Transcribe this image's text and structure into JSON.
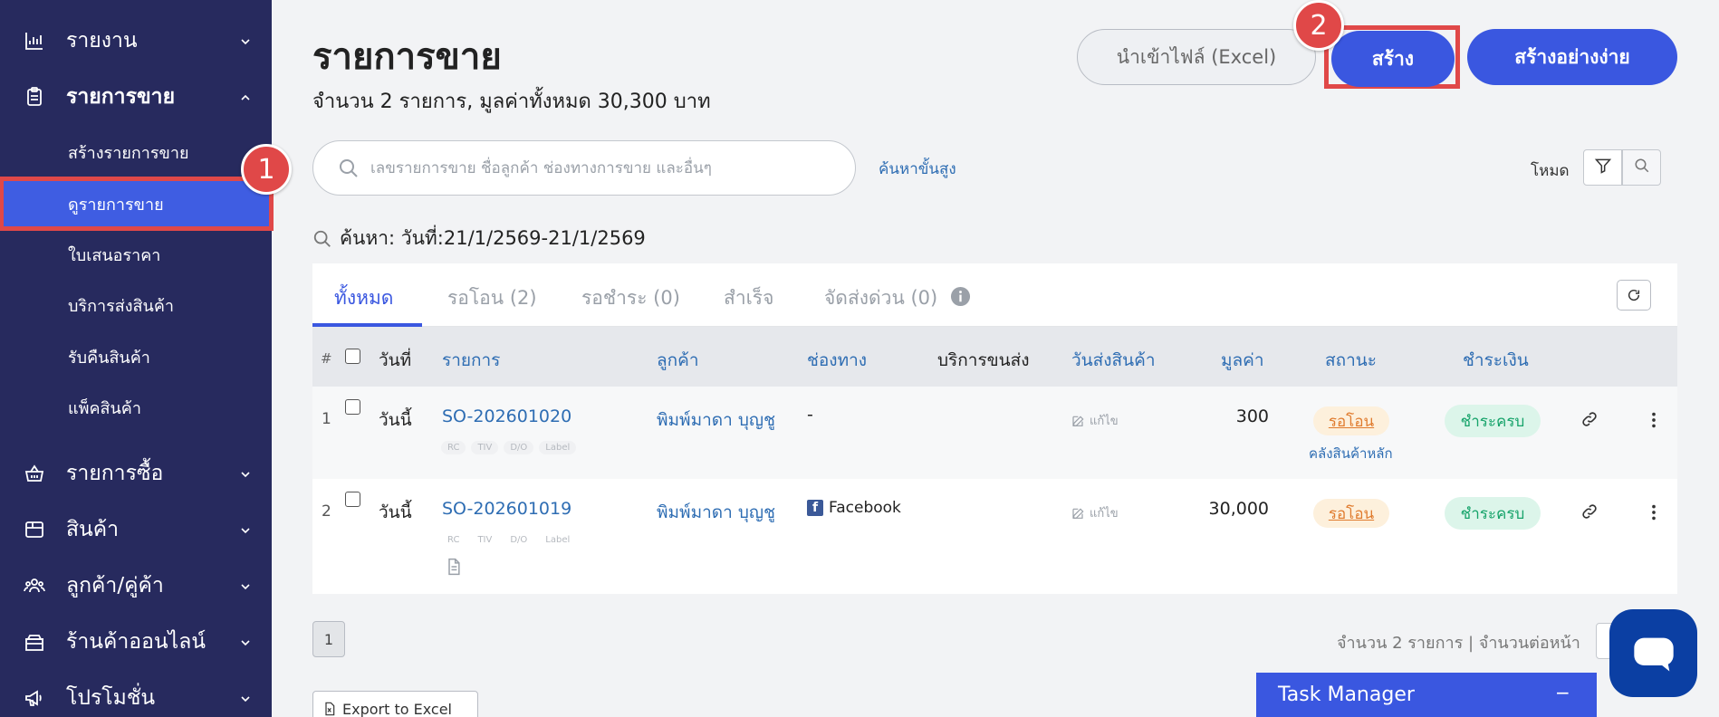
{
  "sidebar": {
    "reports": {
      "label": "รายงาน"
    },
    "sales": {
      "label": "รายการขาย"
    },
    "sales_sub": [
      {
        "label": "สร้างรายการขาย"
      },
      {
        "label": "ดูรายการขาย"
      },
      {
        "label": "ใบเสนอราคา"
      },
      {
        "label": "บริการส่งสินค้า"
      },
      {
        "label": "รับคืนสินค้า"
      },
      {
        "label": "แพ็คสินค้า"
      }
    ],
    "purchases": {
      "label": "รายการซื้อ"
    },
    "products": {
      "label": "สินค้า"
    },
    "customers": {
      "label": "ลูกค้า/คู่ค้า"
    },
    "online_store": {
      "label": "ร้านค้าออนไลน์"
    },
    "promotions": {
      "label": "โปรโมชั่น"
    }
  },
  "annotations": {
    "badge1": "1",
    "badge2": "2"
  },
  "header": {
    "title": "รายการขาย",
    "subtitle": "จำนวน 2 รายการ, มูลค่าทั้งหมด 30,300 บาท",
    "import_button": "นำเข้าไฟล์ (Excel)",
    "create_button": "สร้าง",
    "easy_create_button": "สร้างอย่างง่าย"
  },
  "search": {
    "placeholder": "เลขรายการขาย ชื่อลูกค้า ช่องทางการขาย และอื่นๆ",
    "value": "",
    "advanced_link": "ค้นหาขั้นสูง",
    "mode_label": "โหมด",
    "filter_text": "ค้นหา: วันที่:21/1/2569-21/1/2569"
  },
  "tabs": [
    {
      "label": "ทั้งหมด"
    },
    {
      "label": "รอโอน (2)"
    },
    {
      "label": "รอชำระ (0)"
    },
    {
      "label": "สำเร็จ"
    },
    {
      "label": "จัดส่งด่วน (0)"
    }
  ],
  "table": {
    "hash": "#",
    "columns": {
      "date": "วันที่",
      "order": "รายการ",
      "customer": "ลูกค้า",
      "channel": "ช่องทาง",
      "shipping": "บริการขนส่ง",
      "ship_date": "วันส่งสินค้า",
      "value": "มูลค่า",
      "status": "สถานะ",
      "payment": "ชำระเงิน"
    },
    "rows": [
      {
        "num": "1",
        "date": "วันนี้",
        "order": "SO-202601020",
        "tags": [
          "RC",
          "TIV",
          "D/O",
          "Label"
        ],
        "customer": "พิมพ์มาดา บุญชู",
        "channel": "-",
        "ship_date": "แก้ไข",
        "value": "300",
        "status": "รอโอน",
        "warehouse": "คลังสินค้าหลัก",
        "payment": "ชำระครบ"
      },
      {
        "num": "2",
        "date": "วันนี้",
        "order": "SO-202601019",
        "tags": [
          "RC",
          "TIV",
          "D/O",
          "Label"
        ],
        "customer": "พิมพ์มาดา บุญชู",
        "channel": "Facebook",
        "ship_date": "แก้ไข",
        "value": "30,000",
        "status": "รอโอน",
        "payment": "ชำระครบ"
      }
    ]
  },
  "footer": {
    "page": "1",
    "info": "จำนวน 2 รายการ | จำนวนต่อหน้า",
    "export_button": "Export to Excel",
    "task_manager": "Task Manager",
    "task_manager_minimize": "−"
  },
  "colors": {
    "sidebar_bg": "#272a5e",
    "accent": "#3a57e0",
    "highlight": "#e04848",
    "status_pending": "#e07b2e",
    "status_paid": "#16a36a"
  }
}
